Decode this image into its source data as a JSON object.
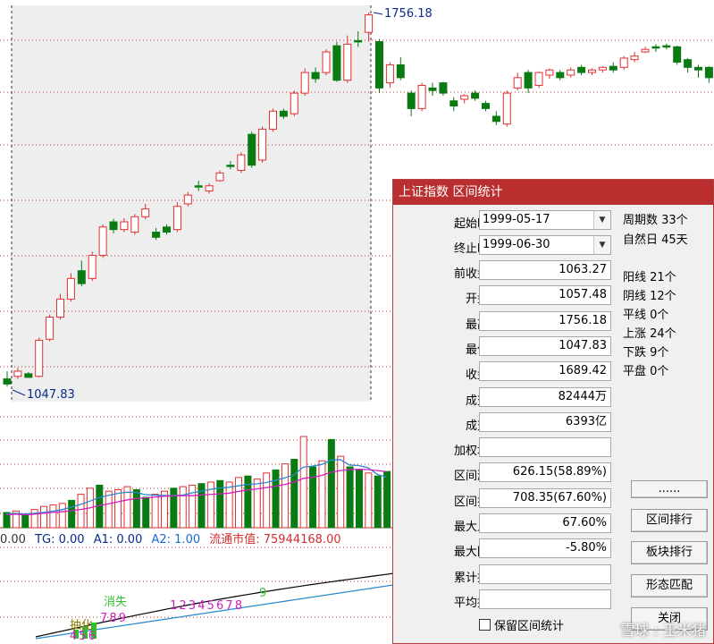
{
  "chart_price": {
    "high_label": "1756.18",
    "low_label": "1047.83",
    "bars": [
      {
        "o": 1045,
        "c": 1035,
        "h": 1060,
        "l": 1030
      },
      {
        "o": 1050,
        "c": 1060,
        "h": 1066,
        "l": 1045
      },
      {
        "o": 1055,
        "c": 1048,
        "h": 1058,
        "l": 1047
      },
      {
        "o": 1050,
        "c": 1120,
        "h": 1125,
        "l": 1048
      },
      {
        "o": 1122,
        "c": 1165,
        "h": 1170,
        "l": 1118
      },
      {
        "o": 1165,
        "c": 1200,
        "h": 1210,
        "l": 1160
      },
      {
        "o": 1200,
        "c": 1240,
        "h": 1250,
        "l": 1195
      },
      {
        "o": 1255,
        "c": 1230,
        "h": 1275,
        "l": 1225
      },
      {
        "o": 1240,
        "c": 1285,
        "h": 1292,
        "l": 1235
      },
      {
        "o": 1285,
        "c": 1340,
        "h": 1345,
        "l": 1280
      },
      {
        "o": 1350,
        "c": 1335,
        "h": 1356,
        "l": 1328
      },
      {
        "o": 1335,
        "c": 1350,
        "h": 1357,
        "l": 1330
      },
      {
        "o": 1330,
        "c": 1360,
        "h": 1365,
        "l": 1325
      },
      {
        "o": 1360,
        "c": 1375,
        "h": 1385,
        "l": 1355
      },
      {
        "o": 1330,
        "c": 1320,
        "h": 1338,
        "l": 1315
      },
      {
        "o": 1340,
        "c": 1330,
        "h": 1345,
        "l": 1325
      },
      {
        "o": 1335,
        "c": 1380,
        "h": 1388,
        "l": 1330
      },
      {
        "o": 1385,
        "c": 1402,
        "h": 1408,
        "l": 1380
      },
      {
        "o": 1420,
        "c": 1418,
        "h": 1430,
        "l": 1410
      },
      {
        "o": 1410,
        "c": 1420,
        "h": 1425,
        "l": 1405
      },
      {
        "o": 1430,
        "c": 1445,
        "h": 1450,
        "l": 1428
      },
      {
        "o": 1460,
        "c": 1458,
        "h": 1468,
        "l": 1452
      },
      {
        "o": 1450,
        "c": 1480,
        "h": 1485,
        "l": 1445
      },
      {
        "o": 1520,
        "c": 1460,
        "h": 1525,
        "l": 1455
      },
      {
        "o": 1470,
        "c": 1530,
        "h": 1535,
        "l": 1465
      },
      {
        "o": 1530,
        "c": 1565,
        "h": 1570,
        "l": 1525
      },
      {
        "o": 1565,
        "c": 1555,
        "h": 1570,
        "l": 1550
      },
      {
        "o": 1560,
        "c": 1600,
        "h": 1605,
        "l": 1555
      },
      {
        "o": 1600,
        "c": 1640,
        "h": 1648,
        "l": 1595
      },
      {
        "o": 1640,
        "c": 1628,
        "h": 1650,
        "l": 1620
      },
      {
        "o": 1640,
        "c": 1680,
        "h": 1685,
        "l": 1635
      },
      {
        "o": 1692,
        "c": 1625,
        "h": 1700,
        "l": 1622
      },
      {
        "o": 1625,
        "c": 1695,
        "h": 1712,
        "l": 1620
      },
      {
        "o": 1702,
        "c": 1700,
        "h": 1720,
        "l": 1690
      },
      {
        "o": 1718,
        "c": 1752,
        "h": 1756,
        "l": 1700
      },
      {
        "o": 1700,
        "c": 1610,
        "h": 1705,
        "l": 1600
      },
      {
        "o": 1620,
        "c": 1655,
        "h": 1660,
        "l": 1610
      },
      {
        "o": 1655,
        "c": 1630,
        "h": 1670,
        "l": 1625
      },
      {
        "o": 1600,
        "c": 1570,
        "h": 1605,
        "l": 1555
      },
      {
        "o": 1570,
        "c": 1615,
        "h": 1620,
        "l": 1565
      },
      {
        "o": 1610,
        "c": 1605,
        "h": 1620,
        "l": 1595
      },
      {
        "o": 1620,
        "c": 1600,
        "h": 1622,
        "l": 1595
      },
      {
        "o": 1585,
        "c": 1575,
        "h": 1592,
        "l": 1565
      },
      {
        "o": 1588,
        "c": 1595,
        "h": 1598,
        "l": 1580
      },
      {
        "o": 1600,
        "c": 1590,
        "h": 1605,
        "l": 1585
      },
      {
        "o": 1580,
        "c": 1570,
        "h": 1585,
        "l": 1565
      },
      {
        "o": 1555,
        "c": 1545,
        "h": 1565,
        "l": 1538
      },
      {
        "o": 1540,
        "c": 1600,
        "h": 1605,
        "l": 1535
      },
      {
        "o": 1610,
        "c": 1630,
        "h": 1640,
        "l": 1605
      },
      {
        "o": 1640,
        "c": 1610,
        "h": 1645,
        "l": 1600
      },
      {
        "o": 1615,
        "c": 1640,
        "h": 1642,
        "l": 1610
      },
      {
        "o": 1635,
        "c": 1645,
        "h": 1648,
        "l": 1628
      },
      {
        "o": 1640,
        "c": 1630,
        "h": 1645,
        "l": 1625
      },
      {
        "o": 1635,
        "c": 1645,
        "h": 1650,
        "l": 1630
      },
      {
        "o": 1650,
        "c": 1640,
        "h": 1655,
        "l": 1635
      },
      {
        "o": 1640,
        "c": 1645,
        "h": 1648,
        "l": 1635
      },
      {
        "o": 1645,
        "c": 1650,
        "h": 1652,
        "l": 1640
      },
      {
        "o": 1652,
        "c": 1645,
        "h": 1660,
        "l": 1640
      },
      {
        "o": 1650,
        "c": 1668,
        "h": 1672,
        "l": 1645
      },
      {
        "o": 1665,
        "c": 1672,
        "h": 1680,
        "l": 1660
      },
      {
        "o": 1680,
        "c": 1685,
        "h": 1690,
        "l": 1678
      },
      {
        "o": 1690,
        "c": 1688,
        "h": 1695,
        "l": 1680
      },
      {
        "o": 1692,
        "c": 1690,
        "h": 1696,
        "l": 1685
      },
      {
        "o": 1690,
        "c": 1660,
        "h": 1692,
        "l": 1655
      },
      {
        "o": 1665,
        "c": 1650,
        "h": 1668,
        "l": 1640
      },
      {
        "o": 1650,
        "c": 1645,
        "h": 1655,
        "l": 1630
      },
      {
        "o": 1650,
        "c": 1630,
        "h": 1652,
        "l": 1620
      },
      {
        "o": 1630,
        "c": 1640,
        "h": 1645,
        "l": 1625
      }
    ],
    "volumes": [
      10,
      11,
      9,
      12,
      14,
      15,
      16,
      18,
      22,
      26,
      28,
      24,
      25,
      27,
      25,
      20,
      22,
      24,
      26,
      27,
      28,
      29,
      30,
      31,
      30,
      33,
      34,
      32,
      36,
      38,
      42,
      45,
      60,
      40,
      44,
      58,
      47,
      40,
      38,
      36,
      34,
      37
    ]
  },
  "indicator": {
    "tg": "TG: 0.00",
    "a1": "A1: 0.00",
    "a2": "A2: 1.00",
    "float_cap": "流通市值: 75944168.00",
    "prefix": "0.00",
    "signal_xiaoshi": "消失",
    "signal_chaohua": "抽化",
    "seq_1": "1 2 3 4 5 6 7 8",
    "seq_2": "9",
    "seq_3": "7 8 9",
    "seq_4": "4 5 6"
  },
  "dialog": {
    "title": "上证指数 区间统计",
    "start_label": "起始时间",
    "start_value": "1999-05-17",
    "end_label": "终止时间",
    "end_value": "1999-06-30",
    "rows": [
      {
        "label": "前收盘价",
        "value": "1063.27"
      },
      {
        "label": "开盘价",
        "value": "1057.48"
      },
      {
        "label": "最高价",
        "value": "1756.18"
      },
      {
        "label": "最低价",
        "value": "1047.83"
      },
      {
        "label": "收盘价",
        "value": "1689.42"
      },
      {
        "label": "成交量",
        "value": "82444万"
      },
      {
        "label": "成交额",
        "value": "6393亿"
      },
      {
        "label": "加权均价",
        "value": ""
      },
      {
        "label": "区间涨幅",
        "value": "626.15(58.89%)"
      },
      {
        "label": "区间振幅",
        "value": "708.35(67.60%)"
      },
      {
        "label": "最大上涨",
        "value": "67.60%"
      },
      {
        "label": "最大回撤",
        "value": "-5.80%"
      },
      {
        "label": "累计换手",
        "value": ""
      },
      {
        "label": "平均换手",
        "value": ""
      }
    ],
    "stats_top": [
      "周期数 33个",
      "自然日 45天"
    ],
    "stats_mid": [
      "阳线 21个",
      "阴线 12个",
      "平线 0个",
      "上涨 24个",
      "下跌 9个",
      "平盘 0个"
    ],
    "buttons": [
      "......",
      "区间排行",
      "板块排行",
      "形态匹配",
      "关闭"
    ],
    "checkbox_label": "保留区间统计",
    "watermark": "雪球 : 玉米猪"
  },
  "colors": {
    "up": "#e03030",
    "down": "#0a7a12",
    "grid": "#c03030",
    "title_bar": "#b92e2e",
    "selection_bg": "#eeeeee",
    "ma_blue": "#2a8ad0",
    "ma_magenta": "#d020c0"
  }
}
